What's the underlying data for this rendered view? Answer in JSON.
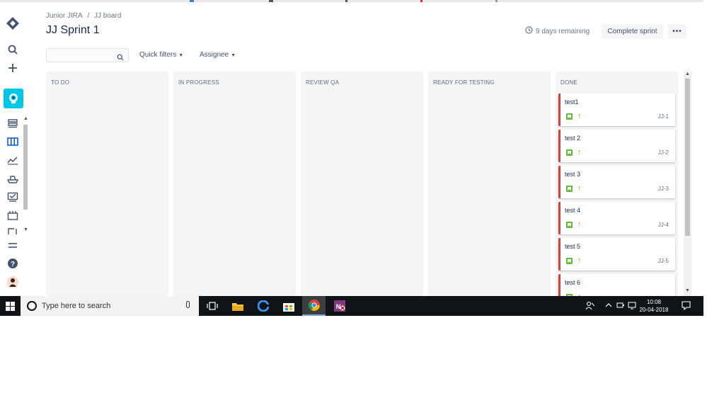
{
  "breadcrumb": [
    "Junior JIRA",
    "/",
    "JJ board"
  ],
  "page_title": "JJ Sprint 1",
  "sprint": {
    "remaining": "9 days remaining",
    "complete_label": "Complete sprint",
    "more_label": "•••"
  },
  "filters": {
    "search_value": "",
    "quick_filters": "Quick filters",
    "assignee": "Assignee"
  },
  "columns": [
    {
      "title": "TO DO",
      "cards": []
    },
    {
      "title": "IN PROGRESS",
      "cards": []
    },
    {
      "title": "REVIEW QA",
      "cards": []
    },
    {
      "title": "READY FOR TESTING",
      "cards": []
    },
    {
      "title": "DONE",
      "cards": [
        {
          "title": "test1",
          "key": "JJ-1"
        },
        {
          "title": "test 2",
          "key": "JJ-2"
        },
        {
          "title": "test 3",
          "key": "JJ-3"
        },
        {
          "title": "test 4",
          "key": "JJ-4"
        },
        {
          "title": "test 5",
          "key": "JJ-5"
        },
        {
          "title": "test 6",
          "key": ""
        }
      ]
    }
  ],
  "taskbar": {
    "search_placeholder": "Type here to search",
    "time": "10:08",
    "date": "20-04-2018"
  },
  "colors": {
    "project_avatar": "#00c7e6",
    "card_flag": "#d04437",
    "story_icon": "#63ba3c",
    "priority": "#f0891d",
    "column_bg": "#f4f5f7"
  },
  "icons": {
    "sidebar": [
      "jira-logo-icon",
      "search-icon",
      "create-icon",
      "project-avatar-icon",
      "backlog-icon",
      "board-icon",
      "reports-icon",
      "releases-icon",
      "issues-icon",
      "components-icon",
      "add-item-icon",
      "menu-icon",
      "help-icon",
      "profile-avatar-icon"
    ]
  }
}
